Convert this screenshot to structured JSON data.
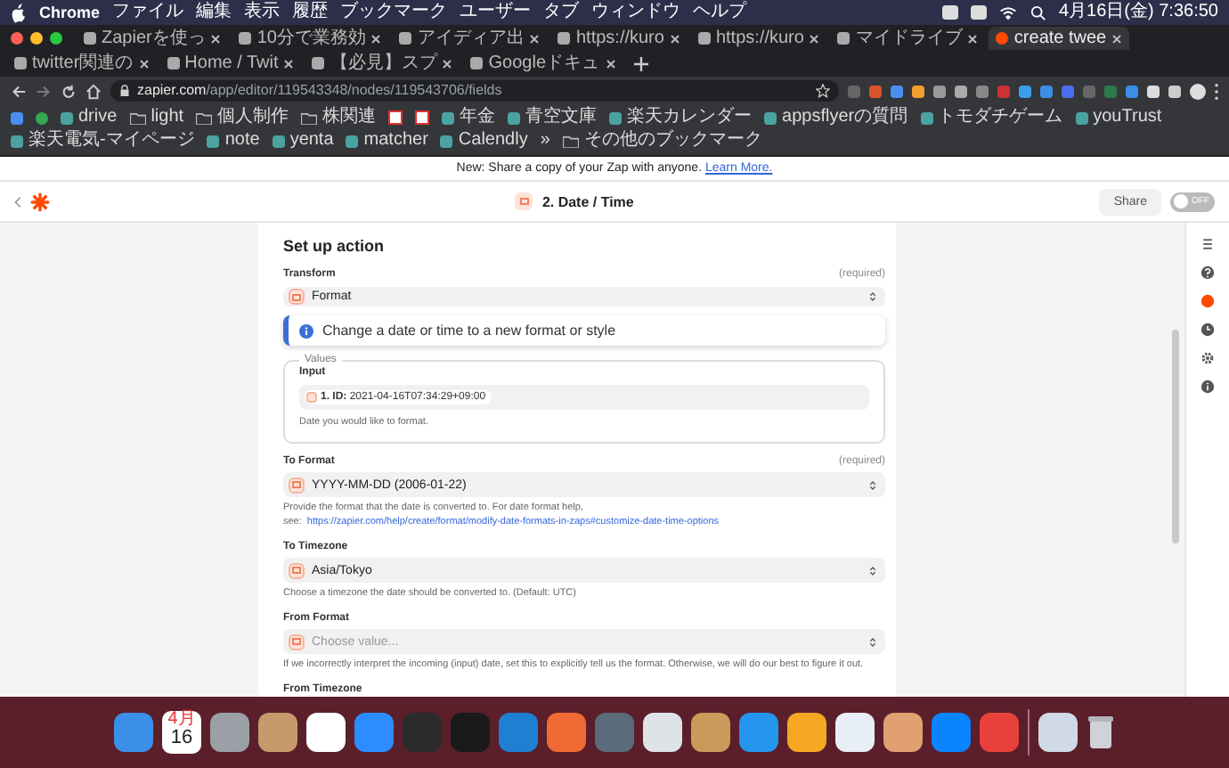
{
  "menubar": {
    "app": "Chrome",
    "menus": [
      "ファイル",
      "編集",
      "表示",
      "履歴",
      "ブックマーク",
      "ユーザー",
      "タブ",
      "ウィンドウ",
      "ヘルプ"
    ],
    "clock": "4月16日(金) 7:36:50"
  },
  "tabs": [
    {
      "title": "Zapierを使っ",
      "selected": false
    },
    {
      "title": "10分で業務効",
      "selected": false
    },
    {
      "title": "アイディア出",
      "selected": false
    },
    {
      "title": "https://kuro",
      "selected": false
    },
    {
      "title": "https://kuro",
      "selected": false
    },
    {
      "title": "マイドライブ",
      "selected": false
    },
    {
      "title": "create twee",
      "selected": true
    },
    {
      "title": "twitter関連の",
      "selected": false
    },
    {
      "title": "Home / Twit",
      "selected": false
    },
    {
      "title": "【必見】スプ",
      "selected": false
    },
    {
      "title": "Googleドキュ",
      "selected": false
    }
  ],
  "address": {
    "host": "zapier.com",
    "path": "/app/editor/119543348/nodes/119543706/fields"
  },
  "bookmarks": [
    {
      "kind": "link",
      "label": "drive"
    },
    {
      "kind": "folder",
      "label": "light"
    },
    {
      "kind": "folder",
      "label": "個人制作"
    },
    {
      "kind": "folder",
      "label": "株関連"
    },
    {
      "kind": "icon"
    },
    {
      "kind": "icon"
    },
    {
      "kind": "link",
      "label": "年金"
    },
    {
      "kind": "link",
      "label": "青空文庫"
    },
    {
      "kind": "link",
      "label": "楽天カレンダー"
    },
    {
      "kind": "link",
      "label": "appsflyerの質問"
    },
    {
      "kind": "link",
      "label": "トモダチゲーム"
    },
    {
      "kind": "link",
      "label": "youTrust"
    },
    {
      "kind": "link",
      "label": "楽天電気-マイページ"
    },
    {
      "kind": "link",
      "label": "note"
    },
    {
      "kind": "link",
      "label": "yenta"
    },
    {
      "kind": "link",
      "label": "matcher"
    },
    {
      "kind": "link",
      "label": "Calendly"
    }
  ],
  "bookmarks_more": "»",
  "other_bookmarks": "その他のブックマーク",
  "banner": {
    "text": "New: Share a copy of your Zap with anyone.",
    "link": "Learn More."
  },
  "header": {
    "step": "2. Date / Time",
    "share": "Share",
    "toggle": {
      "label": "OFF",
      "on": false
    }
  },
  "form": {
    "title": "Set up action",
    "transform": {
      "label": "Transform",
      "required": "(required)",
      "value": "Format"
    },
    "info": "Change a date or time to a new format or style",
    "values": {
      "legend": "Values",
      "label": "Input",
      "chip": "**1. ID:** 2021-04-16T07:34:29+09:00",
      "hint": "Date you would like to format."
    },
    "fields": [
      {
        "label": "To Format",
        "required": "(required)",
        "value": "YYYY-MM-DD (2006-01-22)",
        "help": "Provide the format that the date is converted to. For date format help, see:",
        "link": "https://zapier.com/help/create/format/modify-date-formats-in-zaps#customize-date-time-options"
      },
      {
        "label": "To Timezone",
        "value": "Asia/Tokyo",
        "help": "Choose a timezone the date should be converted to. (Default: UTC)"
      },
      {
        "label": "From Format",
        "placeholder": "Choose value...",
        "help": "If we incorrectly interpret the incoming (input) date, set this to explicitly tell us the format. Otherwise, we will do our best to figure it out."
      },
      {
        "label": "From Timezone"
      }
    ]
  },
  "dock": {
    "month": "4月",
    "day": "16"
  }
}
